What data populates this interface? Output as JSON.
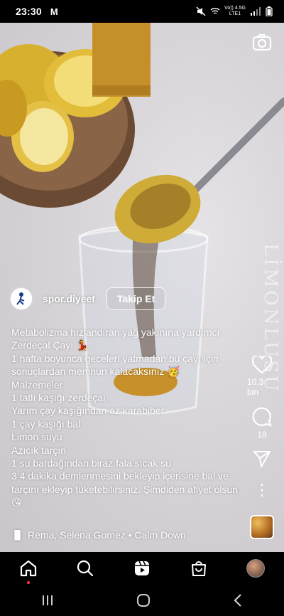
{
  "status_bar": {
    "time": "23:30",
    "notification_app": "M",
    "network_top": "Vo)) 4.5G",
    "network_bottom": "LTE1"
  },
  "reel": {
    "watermark": "LİMONLUSU",
    "username": "spor.diyeet",
    "follow_label": "Takip Et",
    "caption_lines": [
      "Metabolizma hızlandıran yağ yakınına yardımcı Zerdeçal Çayı 💃",
      "1 hafta boyunca geceleri yatmadan bu çayı için sonuçlardan memnun kalacaksınız 🥳",
      "Malzemeler",
      "1 tatlı kaşığı zerdeçal",
      "Yarım çay kaşığından az karabiber",
      "1 çay kaşığı bal",
      "Limon suyu",
      "Azıcık tarçın",
      "1 su bardağından biraz fala sıcak su",
      "3 4 dakika demlenmesini bekleyip içerisine bal ve tarçını ekleyip tüketebilirsiniz. Şimdiden afiyet olsun 😘",
      "."
    ],
    "music": "Rema, Selena Gomez • Calm Down",
    "likes": "10,3 bin",
    "comments": "18"
  },
  "icons": {
    "camera": "camera-icon",
    "heart": "heart-icon",
    "comment": "comment-icon",
    "share": "send-icon",
    "more": "more-icon",
    "home": "home-icon",
    "search": "search-icon",
    "reels": "reels-icon",
    "shop": "shop-icon",
    "profile": "profile-avatar"
  },
  "colors": {
    "accent_red": "#ff3040",
    "background": "#000000",
    "text": "#ffffff"
  }
}
